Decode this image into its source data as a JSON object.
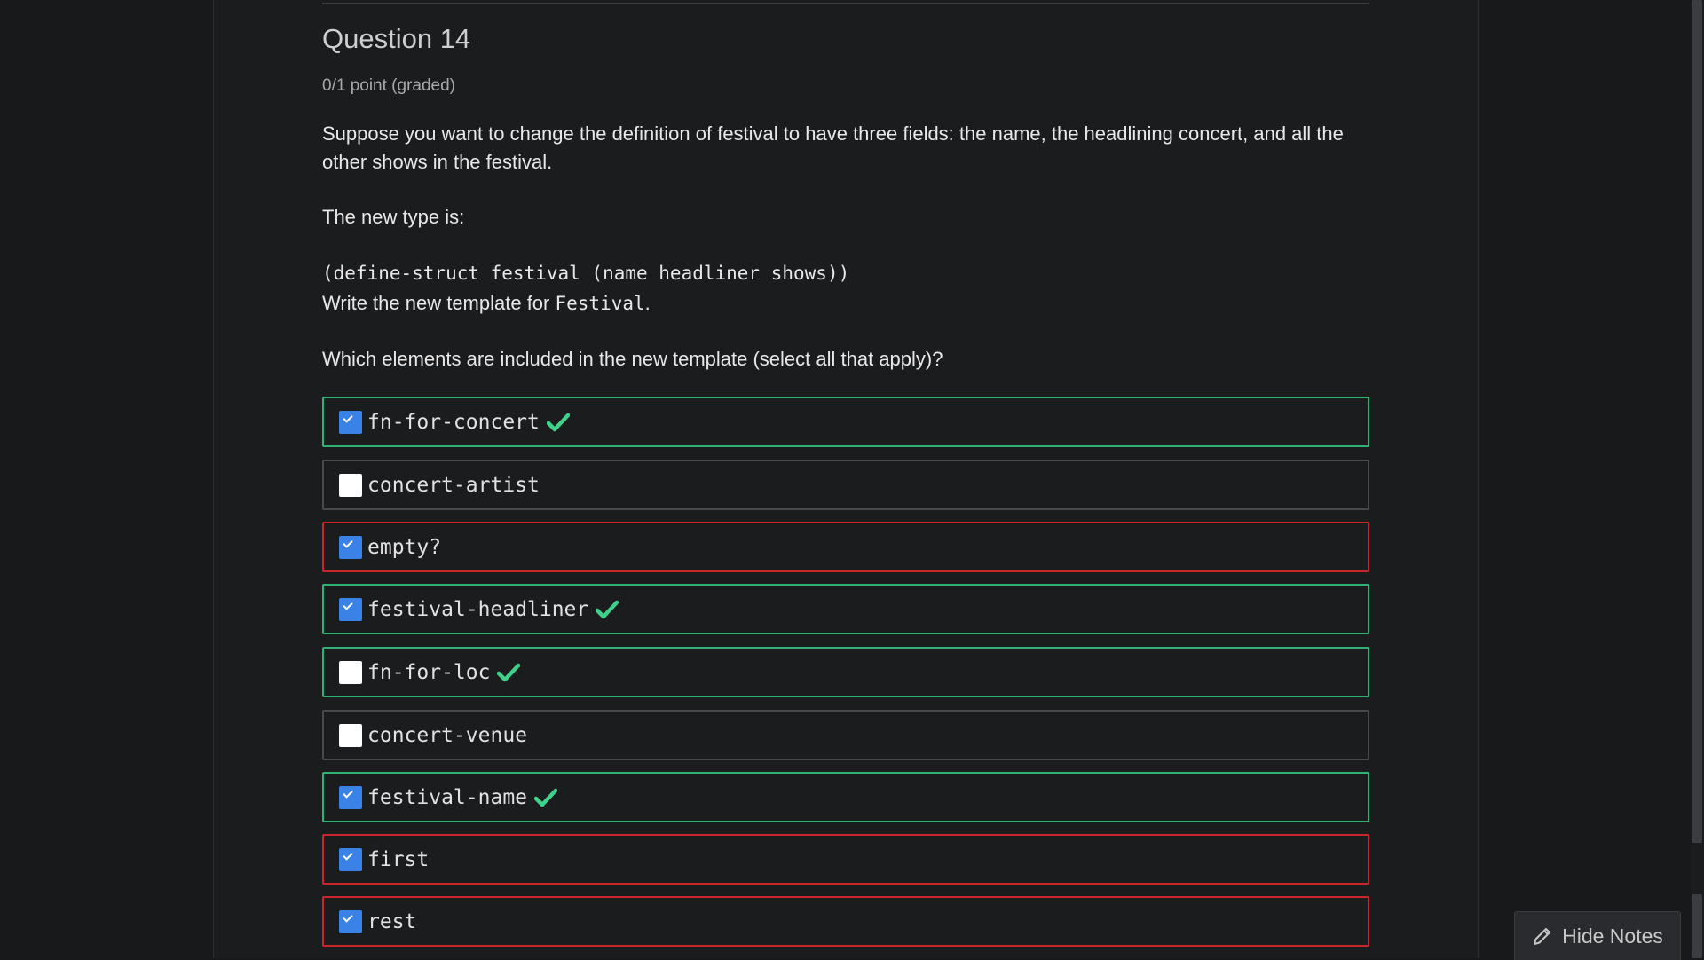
{
  "question": {
    "title": "Question 14",
    "points": "0/1 point (graded)",
    "para1": "Suppose you want to change the definition of festival to have three fields: the name, the headlining concert, and all the other shows in the festival.",
    "para2": "The new type is:",
    "code": "(define-struct festival (name headliner shows))",
    "para3_prefix": "Write the new template for ",
    "para3_code": "Festival",
    "para3_suffix": ".",
    "prompt": "Which elements are included in the new template (select all that apply)?"
  },
  "options": [
    {
      "label": "fn-for-concert",
      "checked": true,
      "status": "correct"
    },
    {
      "label": "concert-artist",
      "checked": false,
      "status": "neutral"
    },
    {
      "label": "empty?",
      "checked": true,
      "status": "incorrect"
    },
    {
      "label": "festival-headliner",
      "checked": true,
      "status": "correct"
    },
    {
      "label": "fn-for-loc",
      "checked": false,
      "status": "correct"
    },
    {
      "label": "concert-venue",
      "checked": false,
      "status": "neutral"
    },
    {
      "label": "festival-name",
      "checked": true,
      "status": "correct"
    },
    {
      "label": "first",
      "checked": true,
      "status": "incorrect"
    },
    {
      "label": "rest",
      "checked": true,
      "status": "incorrect"
    }
  ],
  "notes_button": {
    "label": "Hide Notes",
    "icon": "pencil-icon"
  },
  "colors": {
    "correct": "#2fb374",
    "incorrect": "#c9252b",
    "checkbox_checked": "#3b82e6",
    "checkmark": "#3fd08a"
  }
}
